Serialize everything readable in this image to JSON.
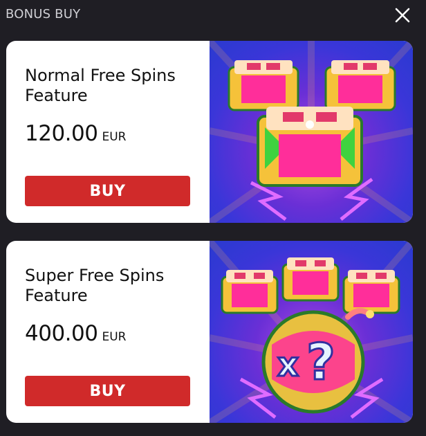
{
  "header": {
    "title": "BONUS BUY"
  },
  "features": [
    {
      "title_line1": "Normal Free Spins",
      "title_line2": "Feature",
      "price": "120.00",
      "currency": "EUR",
      "buy_label": "BUY"
    },
    {
      "title_line1": "Super Free Spins",
      "title_line2": "Feature",
      "price": "400.00",
      "currency": "EUR",
      "buy_label": "BUY"
    }
  ],
  "colors": {
    "background": "#1f1e24",
    "buy_button": "#d02a2a",
    "card": "#ffffff"
  },
  "icons": {
    "close": "close-icon"
  }
}
